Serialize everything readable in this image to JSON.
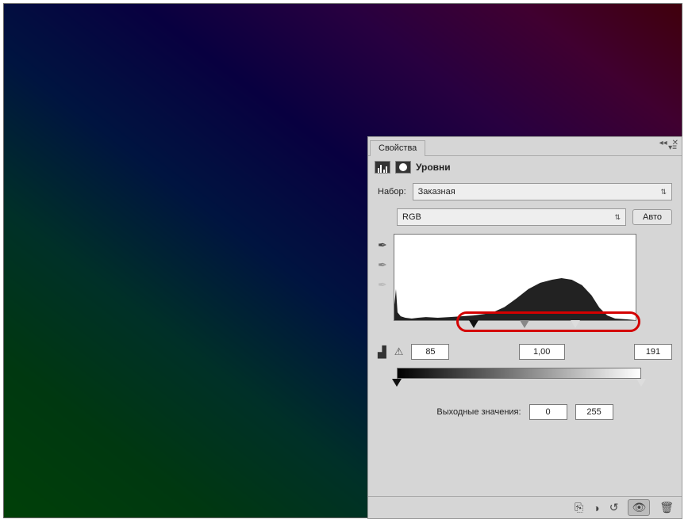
{
  "panel": {
    "tab_label": "Свойства",
    "title": "Уровни",
    "preset_label": "Набор:",
    "preset_value": "Заказная",
    "channel_value": "RGB",
    "auto_label": "Авто",
    "output_label": "Выходные значения:"
  },
  "input_levels": {
    "shadow": "85",
    "mid": "1,00",
    "highlight": "191"
  },
  "output_levels": {
    "shadow": "0",
    "highlight": "255"
  },
  "slider_positions": {
    "in_shadow_pct": 33,
    "in_mid_pct": 54,
    "in_highlight_pct": 75,
    "out_shadow_pct": 0,
    "out_highlight_pct": 100
  },
  "icons": {
    "collapse": "◂◂",
    "close": "✕",
    "menu": "▾≡",
    "eyedrop_black": "✒",
    "eyedrop_gray": "✒",
    "eyedrop_white": "✒",
    "histo_mini": "▟",
    "warn": "⚠",
    "clip": "⎘",
    "eye_mask": "◑",
    "reset": "↺",
    "eye": "👁",
    "trash": "🗑"
  }
}
